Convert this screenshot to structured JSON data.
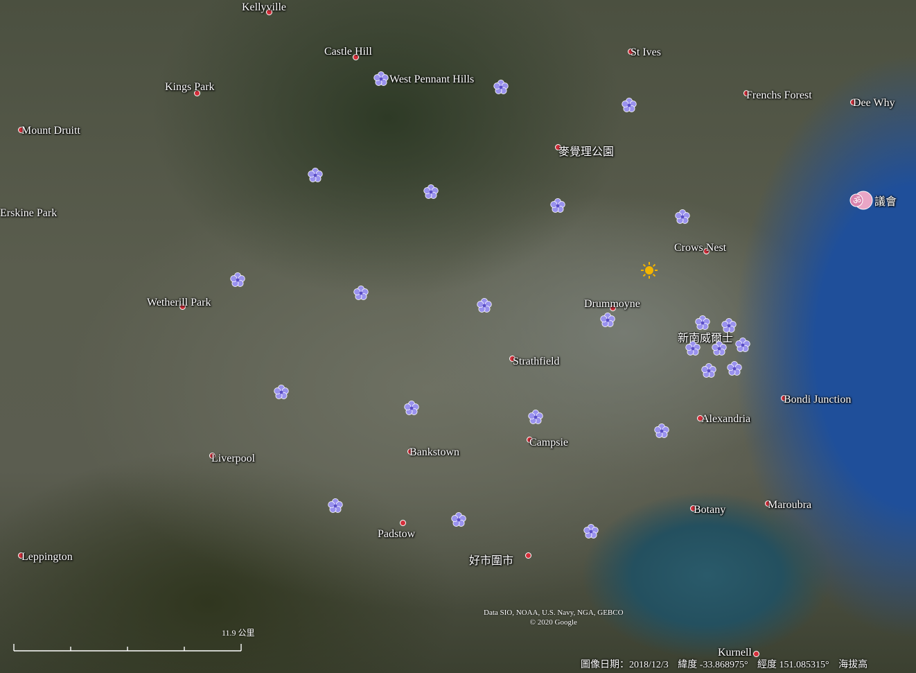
{
  "places": [
    {
      "name": "Kellyville",
      "id": "kellyville"
    },
    {
      "name": "Castle Hill",
      "id": "castle-hill"
    },
    {
      "name": "St Ives",
      "id": "st-ives"
    },
    {
      "name": "West Pennant Hills",
      "id": "west-pennant-hills"
    },
    {
      "name": "Kings Park",
      "id": "kings-park"
    },
    {
      "name": "Frenchs Forest",
      "id": "frenchs-forest"
    },
    {
      "name": "Dee Why",
      "id": "dee-why"
    },
    {
      "name": "Mount Druitt",
      "id": "mount-druitt"
    },
    {
      "name": "麥覺理公園",
      "id": "macquarie-park"
    },
    {
      "name": "議會",
      "id": "council"
    },
    {
      "name": "Erskine Park",
      "id": "erskine-park"
    },
    {
      "name": "Crows Nest",
      "id": "crows-nest"
    },
    {
      "name": "Wetherill Park",
      "id": "wetherill-park"
    },
    {
      "name": "Drummoyne",
      "id": "drummoyne"
    },
    {
      "name": "新南威爾士",
      "id": "new-south-wales"
    },
    {
      "name": "Strathfield",
      "id": "strathfield"
    },
    {
      "name": "Bondi Junction",
      "id": "bondi-junction"
    },
    {
      "name": "Alexandria",
      "id": "alexandria"
    },
    {
      "name": "Campsie",
      "id": "campsie"
    },
    {
      "name": "Bankstown",
      "id": "bankstown"
    },
    {
      "name": "Liverpool",
      "id": "liverpool"
    },
    {
      "name": "Botany",
      "id": "botany"
    },
    {
      "name": "Maroubra",
      "id": "maroubra"
    },
    {
      "name": "Padstow",
      "id": "padstow"
    },
    {
      "name": "Leppington",
      "id": "leppington"
    },
    {
      "name": "好市圍市",
      "id": "hurstville"
    },
    {
      "name": "Kurnell",
      "id": "kurnell"
    }
  ],
  "attribution": {
    "line1": "Data SIO, NOAA, U.S. Navy, NGA, GEBCO",
    "line2": "© 2020 Google"
  },
  "scale": {
    "label": "11.9 公里"
  },
  "status": {
    "image_date": "圖像日期：2018/12/3",
    "latitude": "緯度 -33.868975°",
    "longitude": "經度 151.085315°",
    "elevation": "海拔高"
  },
  "colors": {
    "flower": "#9a92ee",
    "sun": "#f4b400",
    "dot": "#d32e3a",
    "poi": "#e58fb4"
  },
  "markers": {
    "flowers": 27,
    "sun": 1,
    "poi": 1
  }
}
